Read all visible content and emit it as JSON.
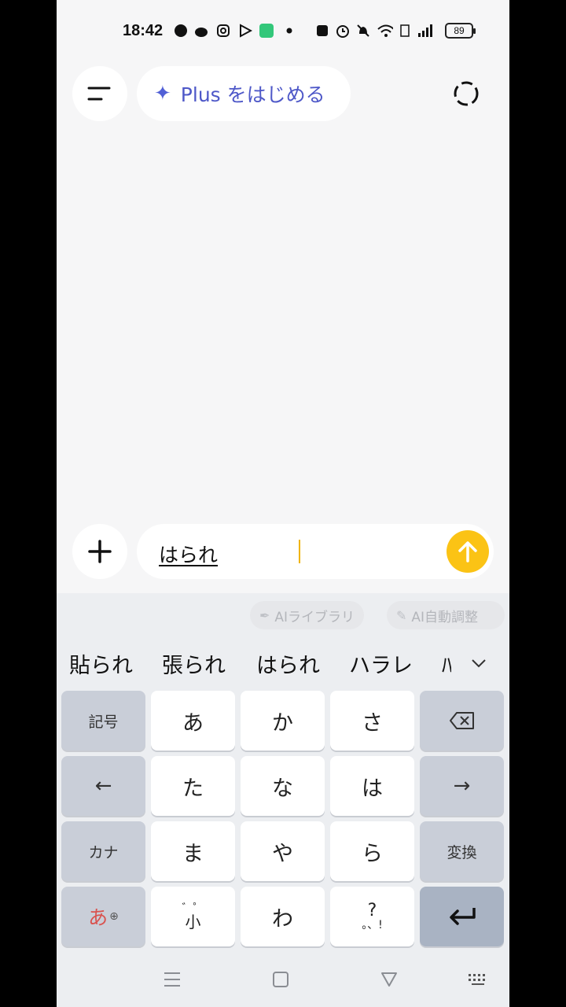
{
  "status_bar": {
    "time": "18:42",
    "battery": "89"
  },
  "header": {
    "plus_label": "Plus をはじめる"
  },
  "composer": {
    "input_value": "はられ"
  },
  "keyboard": {
    "ai_chips": [
      "AIライブラリ",
      "AI自動調整"
    ],
    "candidates": [
      "貼られ",
      "張られ",
      "はられ",
      "ハラレ",
      "ﾊ"
    ],
    "keys": {
      "symbols": "記号",
      "a": "あ",
      "ka": "か",
      "sa": "さ",
      "left": "←",
      "ta": "た",
      "na": "な",
      "ha": "は",
      "right": "→",
      "kana": "カナ",
      "ma": "ま",
      "ya": "や",
      "ra": "ら",
      "convert": "変換",
      "mode": "あ",
      "dakuten_top": "゛゜",
      "dakuten_bottom": "小",
      "wa": "わ",
      "punct_top": "?",
      "punct_bottom": "。、!"
    }
  },
  "colors": {
    "accent_yellow": "#fbc315",
    "plus_blue": "#4e58c8",
    "mode_red": "#d9534f"
  }
}
